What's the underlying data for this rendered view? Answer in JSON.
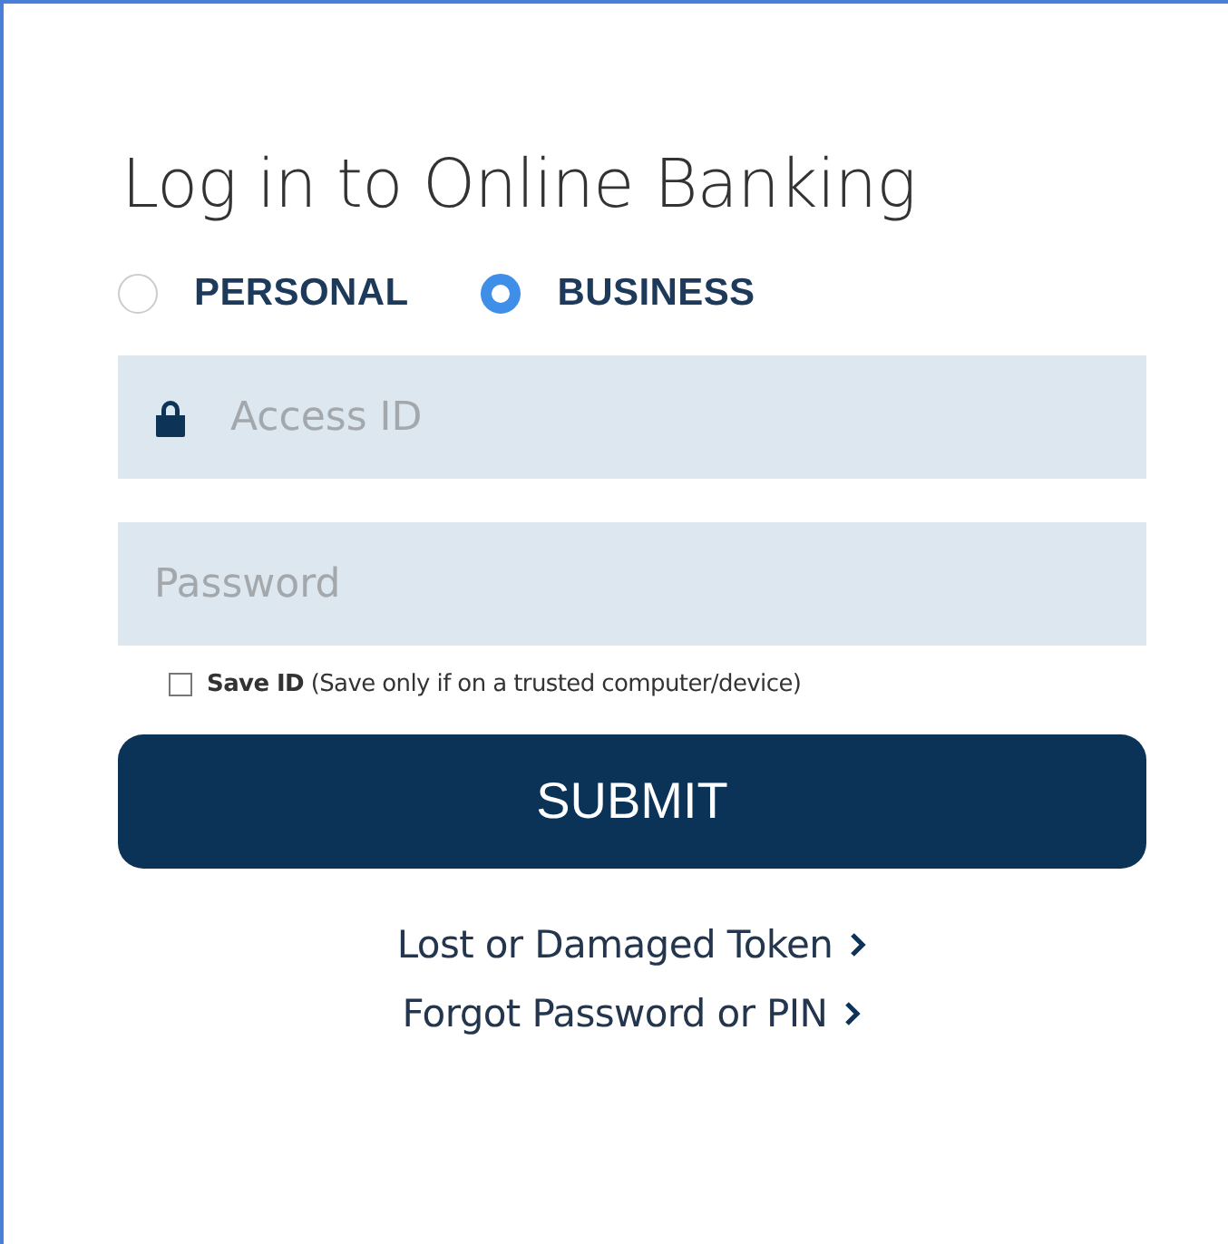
{
  "title": "Log in to Online Banking",
  "account_types": [
    {
      "label": "PERSONAL",
      "selected": false
    },
    {
      "label": "BUSINESS",
      "selected": true
    }
  ],
  "access_id": {
    "placeholder": "Access ID"
  },
  "password": {
    "placeholder": "Password"
  },
  "save_id": {
    "label": "**Save ID** (Save only if on a trusted computer/device)",
    "checked": false
  },
  "submit": "SUBMIT",
  "links": [
    "Lost or Damaged Token",
    "Forgot Password or PIN"
  ]
}
